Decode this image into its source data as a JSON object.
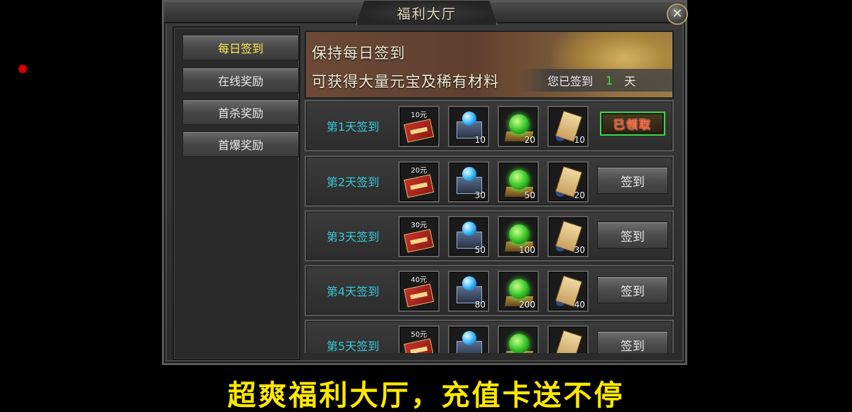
{
  "window": {
    "title": "福利大厅",
    "close_label": "✕"
  },
  "sidebar": {
    "items": [
      {
        "label": "每日签到",
        "active": true,
        "has_notice": false
      },
      {
        "label": "在线奖励",
        "active": false,
        "has_notice": true
      },
      {
        "label": "首杀奖励",
        "active": false,
        "has_notice": false
      },
      {
        "label": "首爆奖励",
        "active": false,
        "has_notice": false
      }
    ]
  },
  "banner": {
    "line1": "保持每日签到",
    "line2": "可获得大量元宝及稀有材料",
    "signed_prefix": "您已签到",
    "signed_count": "1",
    "signed_suffix": "天"
  },
  "rows": [
    {
      "label": "第1天签到",
      "card": "10元",
      "qty_chest": "10",
      "qty_orb": "20",
      "qty_scroll": "10",
      "action": "已领取",
      "claimed": true
    },
    {
      "label": "第2天签到",
      "card": "20元",
      "qty_chest": "30",
      "qty_orb": "50",
      "qty_scroll": "20",
      "action": "签到",
      "claimed": false
    },
    {
      "label": "第3天签到",
      "card": "30元",
      "qty_chest": "50",
      "qty_orb": "100",
      "qty_scroll": "30",
      "action": "签到",
      "claimed": false
    },
    {
      "label": "第4天签到",
      "card": "40元",
      "qty_chest": "80",
      "qty_orb": "200",
      "qty_scroll": "40",
      "action": "签到",
      "claimed": false
    },
    {
      "label": "第5天签到",
      "card": "50元",
      "qty_chest": "",
      "qty_orb": "",
      "qty_scroll": "",
      "action": "签到",
      "claimed": false
    }
  ],
  "icons": {
    "card": "recharge-card-icon",
    "chest": "gem-chest-icon",
    "orb": "green-orb-icon",
    "scroll": "scroll-icon"
  },
  "caption": "超爽福利大厅，充值卡送不停",
  "colors": {
    "accent_yellow": "#ffe800",
    "active_tab": "#ffe84a",
    "row_label": "#36c8d8",
    "signed_count": "#38e838",
    "claimed_text": "#ff4a2a",
    "claimed_border": "#3ed83e"
  }
}
